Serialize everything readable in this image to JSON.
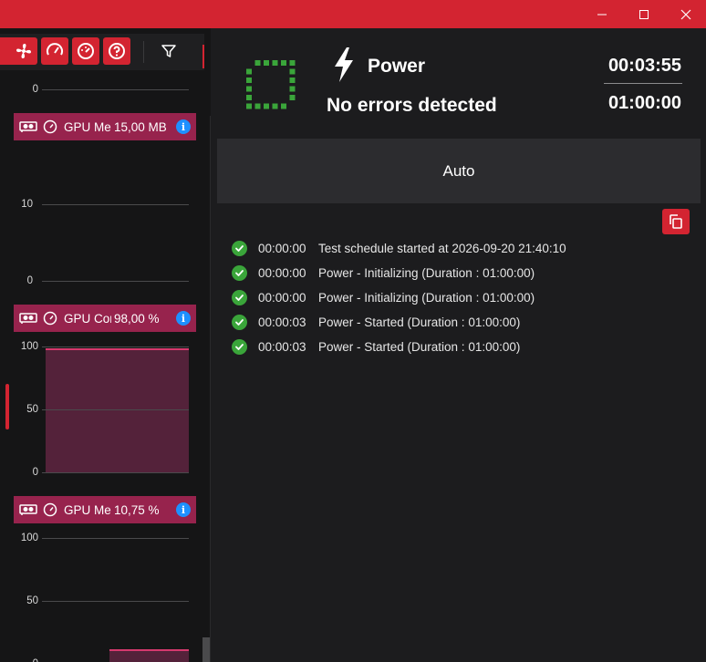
{
  "window": {
    "controls": {
      "minimize_icon": "minimize-icon",
      "maximize_icon": "maximize-icon",
      "close_icon": "close-icon"
    },
    "accent_color": "#d32431"
  },
  "toolbar": {
    "buttons": [
      {
        "icon": "fan-icon"
      },
      {
        "icon": "gauge-icon"
      },
      {
        "icon": "speedometer-icon"
      },
      {
        "icon": "help-icon"
      },
      {
        "icon": "filter-icon"
      }
    ]
  },
  "sensors": {
    "graphs": [
      {
        "name": "GPU Me",
        "value": "15,00 MB",
        "ticks": [
          "0",
          "10",
          "0"
        ]
      },
      {
        "name": "GPU Core",
        "value": "98,00 %",
        "ticks": [
          "100",
          "50",
          "0"
        ],
        "level_percent": 98
      },
      {
        "name": "GPU Men",
        "value": "10,75 %",
        "ticks": [
          "100",
          "50",
          "0"
        ],
        "level_percent": 10.75
      }
    ],
    "header_color": "#97234d",
    "fill_color": "#54223a",
    "line_color": "#d6396e"
  },
  "test": {
    "name": "Power",
    "status": "No errors detected",
    "elapsed": "00:03:55",
    "total": "01:00:00",
    "mode": "Auto",
    "status_color": "#3aa53a"
  },
  "log": [
    {
      "time": "00:00:00",
      "message": "Test schedule started at 2026-09-20 21:40:10"
    },
    {
      "time": "00:00:00",
      "message": "Power - Initializing (Duration : 01:00:00)"
    },
    {
      "time": "00:00:00",
      "message": "Power - Initializing (Duration : 01:00:00)"
    },
    {
      "time": "00:00:03",
      "message": "Power - Started (Duration : 01:00:00)"
    },
    {
      "time": "00:00:03",
      "message": "Power - Started (Duration : 01:00:00)"
    }
  ]
}
